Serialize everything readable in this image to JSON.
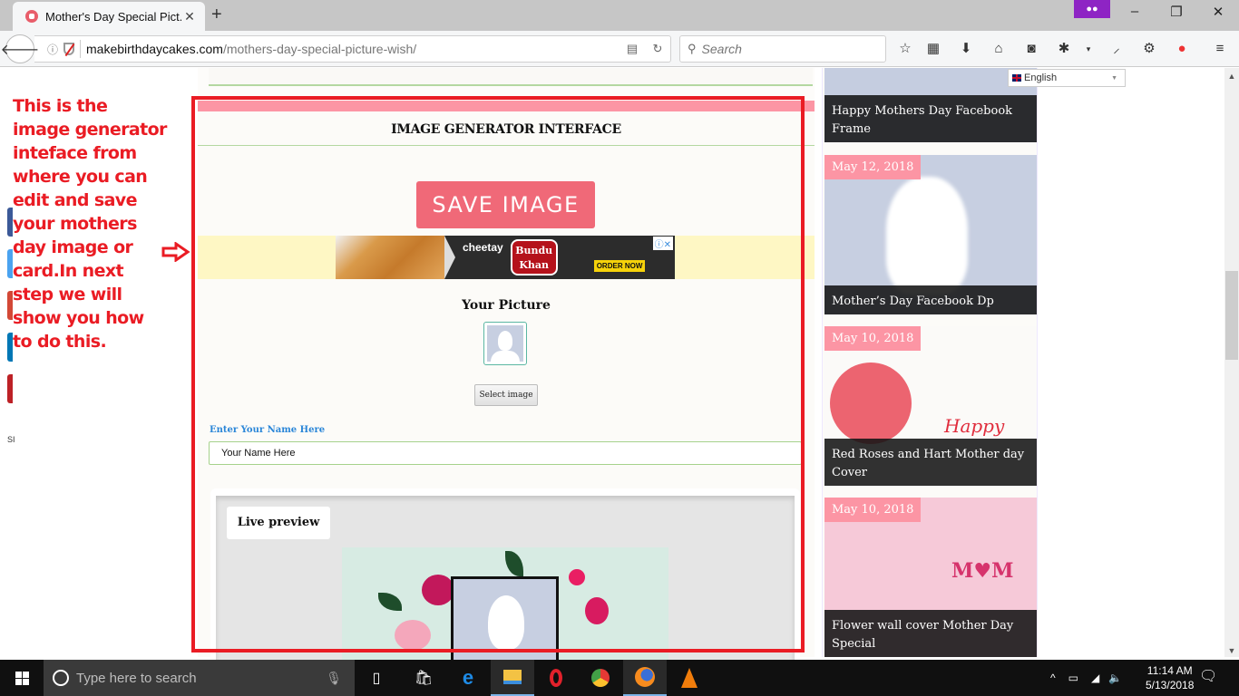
{
  "browser": {
    "tab_title": "Mother's Day Special Pict...",
    "url_host": "makebirthdaycakes.com",
    "url_path": "/mothers-day-special-picture-wish/",
    "search_placeholder": "Search",
    "toolbar_icons": [
      "bookmark-star-icon",
      "reading-list-icon",
      "download-icon",
      "home-icon",
      "pocket-icon",
      "bug-extension-icon",
      "dropdown-icon",
      "dropper-icon",
      "gear-extension-icon",
      "color-dots-icon",
      "hamburger-menu-icon"
    ]
  },
  "annotation": {
    "text": "This is the image generator inteface from where you can edit and save your mothers day image or card.In next step we will show you how to do this.",
    "color": "#ea1c24"
  },
  "left_stub": {
    "text": "SI"
  },
  "generator": {
    "title": "IMAGE GENERATOR INTERFACE",
    "save_button": "SAVE IMAGE",
    "ad": {
      "brand": "cheetay",
      "logo_line1": "Bundu",
      "logo_line2": "Khan",
      "cta": "ORDER NOW",
      "info": "ⓘ✕"
    },
    "your_picture_label": "Your Picture",
    "select_image_button": "Select image",
    "name_label": "Enter Your Name Here",
    "name_value": "Your Name Here",
    "live_preview_label": "Live preview"
  },
  "language": {
    "selected": "English"
  },
  "sidebar": {
    "posts": [
      {
        "date": "",
        "title": "Happy Mothers Day Facebook Frame"
      },
      {
        "date": "May 12, 2018",
        "title": "Mother’s Day Facebook Dp"
      },
      {
        "date": "May 10, 2018",
        "title": "Red Roses and Hart Mother day Cover"
      },
      {
        "date": "May 10, 2018",
        "title": "Flower wall cover Mother Day Special"
      }
    ]
  },
  "taskbar": {
    "search_placeholder": "Type here to search",
    "time": "11:14 AM",
    "date": "5/13/2018"
  },
  "colors": {
    "accent_pink": "#fc95a4",
    "save_button": "#f06978",
    "highlight_red": "#ea1c24"
  }
}
